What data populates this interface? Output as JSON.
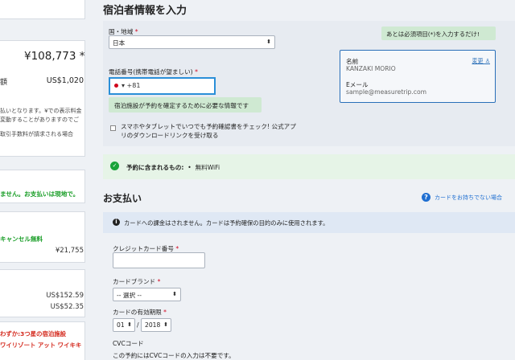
{
  "sidebar": {
    "price_main": "¥108,773 *",
    "price_usd_label": "額",
    "price_usd": "US$1,020",
    "notes": [
      "払いとなります。¥での表示料金",
      "変動することがありますのでご",
      "取引手数料が請求される場合"
    ],
    "payment_note": "ません。お支払いは現地で。",
    "cancel_label": "キャンセル無料",
    "cancel_price": "¥21,755",
    "usd_1": "US$152.59",
    "usd_2": "US$52.35",
    "promo_lines": [
      "わずか:3つ星の宿泊施設",
      "ワイリゾート アット ワイキキ"
    ]
  },
  "guest": {
    "title": "宿泊者情報を入力",
    "country_label": "国・地域",
    "country_value": "日本",
    "required_mark": "*",
    "phone_label": "電話番号(携帯電話が望ましい)",
    "phone_value": "▾ +81",
    "phone_tip": "宿泊施設が予約を確定するために必要な情報です",
    "required_tip": "あとは必須項目(*)を入力するだけ!",
    "box": {
      "name_label": "名前",
      "name_value": "KANZAKI MORIO",
      "email_label": "Eメール",
      "email_value": "sample@measuretrip.com",
      "change_link": "変更"
    },
    "checkbox_text": "スマホやタブレットでいつでも予約確認書をチェック! 公式アプリのダウンロードリンクを受け取る"
  },
  "included": {
    "label": "予約に含まれるもの:",
    "bullet": "•",
    "item": "無料WiFi"
  },
  "payment": {
    "title": "お支払い",
    "help_link": "カードをお持ちでない場合",
    "info": "カードへの課金はされません。カードは予約確保の目的のみに使用されます。",
    "card_number_label": "クレジットカード番号",
    "brand_label": "カードブランド",
    "brand_value": "-- 選択 --",
    "expiry_label": "カードの有効期限",
    "month_value": "01",
    "slash": "/",
    "year_value": "2018",
    "cvc_label": "CVCコード",
    "cvc_note": "この予約にはCVCコードの入力は不要です。"
  },
  "icons": {
    "check": "check-circle-icon",
    "info": "info-icon",
    "help": "help-icon",
    "person": "person-icon",
    "select_arrow": "updown-arrow-icon"
  },
  "colors": {
    "required": "#d0021b",
    "green": "#1a9e28",
    "focus_blue": "#2a8fd8",
    "link_blue": "#1f6fd1"
  }
}
